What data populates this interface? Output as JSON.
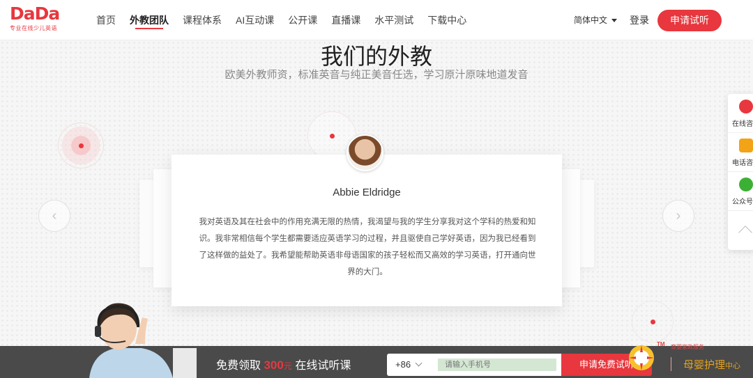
{
  "logo": {
    "name": "DaDa",
    "tagline": "专业在线少儿英语"
  },
  "nav": {
    "items": [
      {
        "label": "首页",
        "active": false
      },
      {
        "label": "外教团队",
        "active": true
      },
      {
        "label": "课程体系",
        "active": false
      },
      {
        "label": "AI互动课",
        "active": false
      },
      {
        "label": "公开课",
        "active": false
      },
      {
        "label": "直播课",
        "active": false
      },
      {
        "label": "水平测试",
        "active": false
      },
      {
        "label": "下载中心",
        "active": false
      }
    ],
    "language": "简体中文",
    "login": "登录",
    "apply": "申请试听"
  },
  "section": {
    "title": "我们的外教",
    "subtitle": "欧美外教师资，标准英音与纯正美音任选，学习原汁原味地道发音"
  },
  "teacher": {
    "name": "Abbie Eldridge",
    "bio": "我对英语及其在社会中的作用充满无限的热情，我渴望与我的学生分享我对这个学科的热爱和知识。我非常相信每个学生都需要适应英语学习的过程，并且驱使自己学好英语，因为我已经看到了这样做的益处了。我希望能帮助英语非母语国家的孩子轻松而又高效的学习英语，打开通向世界的大门。"
  },
  "side_panel": {
    "items": [
      {
        "label": "在线咨",
        "icon": "headset-icon"
      },
      {
        "label": "电话咨",
        "icon": "phone-icon"
      },
      {
        "label": "公众号",
        "icon": "wechat-icon"
      }
    ]
  },
  "banner": {
    "text_before": "免费领取",
    "amount": "300",
    "unit": "元",
    "text_after": "在线试听课",
    "country_code": "+86",
    "phone_placeholder": "请输入手机号",
    "submit": "申请免费试听"
  },
  "watermark": {
    "tm": "TM",
    "sub": "育婴家政服务",
    "brand": "母婴护理",
    "brand_suffix": "中心"
  },
  "colors": {
    "accent": "#e8373e",
    "bar": "#4a4a4a"
  }
}
